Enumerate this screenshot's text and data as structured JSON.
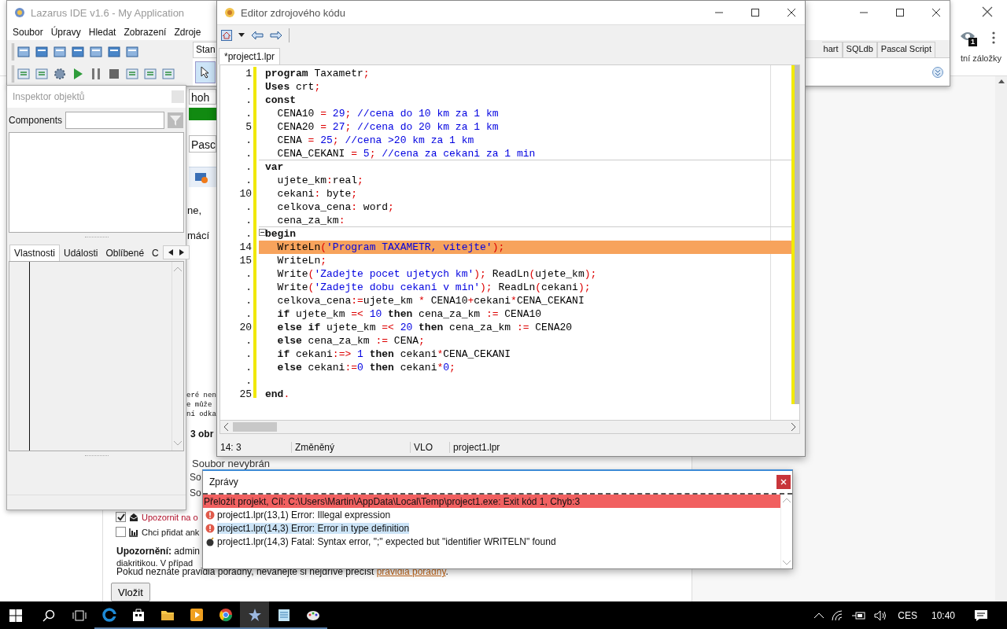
{
  "browser": {
    "bookmarks_text": "tní záložky",
    "badge": "1"
  },
  "page": {
    "field_value": "hoh",
    "dropdown_value": "Pasc",
    "paragraph_fragments": [
      "ne,",
      "mácí"
    ],
    "notice_fragments": [
      "eré nen",
      "e může",
      "ní odka"
    ],
    "heading_fragment": "3 obr",
    "file_status": "Soubor nevybrán",
    "file_fragments": [
      "So",
      "So"
    ],
    "checkboxes": [
      {
        "kind": "mail",
        "label": "Upozornit na o",
        "checked": true
      },
      {
        "kind": "chart",
        "label": "Chci přidat ank",
        "checked": false
      }
    ],
    "notice": "**Upozornění:** admin",
    "notice_line_2": "diakritikou. V případ",
    "rules_text": "Pokud neznáte pravidla poradny, neváhejte si nejdříve přečíst ",
    "rules_link": "pravidla poradny",
    "rules_end": ".",
    "submit": "Vložit"
  },
  "ide": {
    "title": "Lazarus IDE v1.6 - My Application",
    "menu": [
      "Soubor",
      "Úpravy",
      "Hledat",
      "Zobrazení",
      "Zdroje"
    ],
    "palette_tabs": [
      {
        "label": "Stan",
        "selected": true
      },
      {
        "label": "hart",
        "selected": false
      },
      {
        "label": "SQLdb",
        "selected": false
      },
      {
        "label": "Pascal Script",
        "selected": false
      }
    ]
  },
  "editor": {
    "title": "Editor zdrojového kódu",
    "tabs": [
      {
        "label": "*project1.lpr",
        "selected": true
      }
    ],
    "lines": [
      {
        "number": "1",
        "error": false,
        "fold_end": false,
        "tokens": [
          {
            "kind": "kw",
            "text": "program"
          },
          {
            "kind": "id",
            "text": " Taxametr"
          },
          {
            "kind": "sym",
            "text": ";"
          }
        ]
      },
      {
        "number": ".",
        "error": false,
        "fold_end": false,
        "tokens": [
          {
            "kind": "kw",
            "text": "Uses"
          },
          {
            "kind": "id",
            "text": " crt"
          },
          {
            "kind": "sym",
            "text": ";"
          }
        ]
      },
      {
        "number": ".",
        "error": false,
        "fold_end": false,
        "tokens": [
          {
            "kind": "kw",
            "text": "const"
          }
        ]
      },
      {
        "number": ".",
        "error": false,
        "fold_end": false,
        "tokens": [
          {
            "kind": "id",
            "text": "  CENA10 "
          },
          {
            "kind": "sym",
            "text": "="
          },
          {
            "kind": "num",
            "text": " 29"
          },
          {
            "kind": "sym",
            "text": ";"
          },
          {
            "kind": "com",
            "text": " //cena do 10 km za 1 km"
          }
        ]
      },
      {
        "number": "5",
        "error": false,
        "fold_end": false,
        "tokens": [
          {
            "kind": "id",
            "text": "  CENA20 "
          },
          {
            "kind": "sym",
            "text": "="
          },
          {
            "kind": "num",
            "text": " 27"
          },
          {
            "kind": "sym",
            "text": ";"
          },
          {
            "kind": "com",
            "text": " //cena do 20 km za 1 km"
          }
        ]
      },
      {
        "number": ".",
        "error": false,
        "fold_end": false,
        "tokens": [
          {
            "kind": "id",
            "text": "  CENA "
          },
          {
            "kind": "sym",
            "text": "="
          },
          {
            "kind": "num",
            "text": " 25"
          },
          {
            "kind": "sym",
            "text": ";"
          },
          {
            "kind": "com",
            "text": " //cena >20 km za 1 km"
          }
        ]
      },
      {
        "number": ".",
        "error": false,
        "fold_end": true,
        "tokens": [
          {
            "kind": "id",
            "text": "  CENA_CEKANI "
          },
          {
            "kind": "sym",
            "text": "="
          },
          {
            "kind": "num",
            "text": " 5"
          },
          {
            "kind": "sym",
            "text": ";"
          },
          {
            "kind": "com",
            "text": " //cena za cekani za 1 min"
          }
        ]
      },
      {
        "number": ".",
        "error": false,
        "fold_end": false,
        "tokens": [
          {
            "kind": "kw",
            "text": "var"
          }
        ]
      },
      {
        "number": ".",
        "error": false,
        "fold_end": false,
        "tokens": [
          {
            "kind": "id",
            "text": "  ujete_km"
          },
          {
            "kind": "sym",
            "text": ":"
          },
          {
            "kind": "id",
            "text": "real"
          },
          {
            "kind": "sym",
            "text": ";"
          }
        ]
      },
      {
        "number": "10",
        "error": false,
        "fold_end": false,
        "tokens": [
          {
            "kind": "id",
            "text": "  cekani"
          },
          {
            "kind": "sym",
            "text": ":"
          },
          {
            "kind": "id",
            "text": " byte"
          },
          {
            "kind": "sym",
            "text": ";"
          }
        ]
      },
      {
        "number": ".",
        "error": false,
        "fold_end": false,
        "tokens": [
          {
            "kind": "id",
            "text": "  celkova_cena"
          },
          {
            "kind": "sym",
            "text": ":"
          },
          {
            "kind": "id",
            "text": " word"
          },
          {
            "kind": "sym",
            "text": ";"
          }
        ]
      },
      {
        "number": ".",
        "error": false,
        "fold_end": true,
        "tokens": [
          {
            "kind": "id",
            "text": "  cena_za_km"
          },
          {
            "kind": "sym",
            "text": ":"
          }
        ]
      },
      {
        "number": ".",
        "error": false,
        "fold_end": false,
        "tokens": [
          {
            "kind": "kw",
            "text": "begin"
          }
        ]
      },
      {
        "number": "14",
        "error": true,
        "fold_end": false,
        "tokens": [
          {
            "kind": "id",
            "text": "  WriteLn"
          },
          {
            "kind": "sym",
            "text": "("
          },
          {
            "kind": "str",
            "text": "'Program TAXAMETR, vitejte'"
          },
          {
            "kind": "sym",
            "text": ");"
          }
        ]
      },
      {
        "number": "15",
        "error": false,
        "fold_end": false,
        "tokens": [
          {
            "kind": "id",
            "text": "  WriteLn"
          },
          {
            "kind": "sym",
            "text": ";"
          }
        ]
      },
      {
        "number": ".",
        "error": false,
        "fold_end": false,
        "tokens": [
          {
            "kind": "id",
            "text": "  Write"
          },
          {
            "kind": "sym",
            "text": "("
          },
          {
            "kind": "str",
            "text": "'Zadejte pocet ujetych km'"
          },
          {
            "kind": "sym",
            "text": ");"
          },
          {
            "kind": "id",
            "text": " ReadLn"
          },
          {
            "kind": "sym",
            "text": "("
          },
          {
            "kind": "id",
            "text": "ujete_km"
          },
          {
            "kind": "sym",
            "text": ");"
          }
        ]
      },
      {
        "number": ".",
        "error": false,
        "fold_end": false,
        "tokens": [
          {
            "kind": "id",
            "text": "  Write"
          },
          {
            "kind": "sym",
            "text": "("
          },
          {
            "kind": "str",
            "text": "'Zadejte dobu cekani v min'"
          },
          {
            "kind": "sym",
            "text": ");"
          },
          {
            "kind": "id",
            "text": " ReadLn"
          },
          {
            "kind": "sym",
            "text": "("
          },
          {
            "kind": "id",
            "text": "cekani"
          },
          {
            "kind": "sym",
            "text": ");"
          }
        ]
      },
      {
        "number": ".",
        "error": false,
        "fold_end": false,
        "tokens": [
          {
            "kind": "id",
            "text": "  celkova_cena"
          },
          {
            "kind": "sym",
            "text": ":="
          },
          {
            "kind": "id",
            "text": "ujete_km "
          },
          {
            "kind": "sym",
            "text": "*"
          },
          {
            "kind": "id",
            "text": " CENA10"
          },
          {
            "kind": "sym",
            "text": "+"
          },
          {
            "kind": "id",
            "text": "cekani"
          },
          {
            "kind": "sym",
            "text": "*"
          },
          {
            "kind": "id",
            "text": "CENA_CEKANI"
          }
        ]
      },
      {
        "number": ".",
        "error": false,
        "fold_end": false,
        "tokens": [
          {
            "kind": "kw",
            "text": "  if"
          },
          {
            "kind": "id",
            "text": " ujete_km "
          },
          {
            "kind": "sym",
            "text": "=<"
          },
          {
            "kind": "num",
            "text": " 10 "
          },
          {
            "kind": "kw",
            "text": "then"
          },
          {
            "kind": "id",
            "text": " cena_za_km "
          },
          {
            "kind": "sym",
            "text": ":="
          },
          {
            "kind": "id",
            "text": " CENA10"
          }
        ]
      },
      {
        "number": "20",
        "error": false,
        "fold_end": false,
        "tokens": [
          {
            "kind": "kw",
            "text": "  else if"
          },
          {
            "kind": "id",
            "text": " ujete_km "
          },
          {
            "kind": "sym",
            "text": "=<"
          },
          {
            "kind": "num",
            "text": " 20 "
          },
          {
            "kind": "kw",
            "text": "then"
          },
          {
            "kind": "id",
            "text": " cena_za_km "
          },
          {
            "kind": "sym",
            "text": ":="
          },
          {
            "kind": "id",
            "text": " CENA20"
          }
        ]
      },
      {
        "number": ".",
        "error": false,
        "fold_end": false,
        "tokens": [
          {
            "kind": "kw",
            "text": "  else"
          },
          {
            "kind": "id",
            "text": " cena_za_km "
          },
          {
            "kind": "sym",
            "text": ":="
          },
          {
            "kind": "id",
            "text": " CENA"
          },
          {
            "kind": "sym",
            "text": ";"
          }
        ]
      },
      {
        "number": ".",
        "error": false,
        "fold_end": false,
        "tokens": [
          {
            "kind": "kw",
            "text": "  if"
          },
          {
            "kind": "id",
            "text": " cekani"
          },
          {
            "kind": "sym",
            "text": ":=>"
          },
          {
            "kind": "num",
            "text": " 1 "
          },
          {
            "kind": "kw",
            "text": "then"
          },
          {
            "kind": "id",
            "text": " cekani"
          },
          {
            "kind": "sym",
            "text": "*"
          },
          {
            "kind": "id",
            "text": "CENA_CEKANI"
          }
        ]
      },
      {
        "number": ".",
        "error": false,
        "fold_end": false,
        "tokens": [
          {
            "kind": "kw",
            "text": "  else"
          },
          {
            "kind": "id",
            "text": " cekani"
          },
          {
            "kind": "sym",
            "text": ":="
          },
          {
            "kind": "num",
            "text": "0 "
          },
          {
            "kind": "kw",
            "text": "then"
          },
          {
            "kind": "id",
            "text": " cekani"
          },
          {
            "kind": "sym",
            "text": "*"
          },
          {
            "kind": "num",
            "text": "0"
          },
          {
            "kind": "sym",
            "text": ";"
          }
        ]
      },
      {
        "number": ".",
        "error": false,
        "fold_end": false
      },
      {
        "number": "25",
        "error": false,
        "fold_end": false,
        "tokens": [
          {
            "kind": "kw",
            "text": "end"
          },
          {
            "kind": "sym",
            "text": "."
          }
        ]
      }
    ],
    "status": [
      "14:  3",
      "Změněný",
      "VLO",
      "project1.lpr"
    ]
  },
  "inspector": {
    "title": "Inspektor objektů",
    "components_label": "Components",
    "tabs": [
      {
        "label": "Vlastnosti",
        "selected": true
      },
      {
        "label": "Události",
        "selected": false
      },
      {
        "label": "Oblíbené",
        "selected": false
      },
      {
        "label": "C",
        "selected": false
      }
    ]
  },
  "messages": {
    "title": "Zprávy",
    "rows": [
      {
        "kind": "summary",
        "text": "Přeložit projekt, Cíl: C:\\Users\\Martin\\AppData\\Local\\Temp\\project1.exe: Exit kód 1, Chyb:3",
        "selected": false
      },
      {
        "kind": "error",
        "text": "project1.lpr(13,1) Error: Illegal expression",
        "selected": false
      },
      {
        "kind": "error",
        "text": "project1.lpr(14,3) Error: Error in type definition",
        "selected": true
      },
      {
        "kind": "fatal",
        "text": "project1.lpr(14,3) Fatal: Syntax error, \";\" expected but \"identifier WRITELN\" found",
        "selected": false
      }
    ]
  },
  "taskbar": {
    "language": "CES",
    "time": "10:40"
  }
}
